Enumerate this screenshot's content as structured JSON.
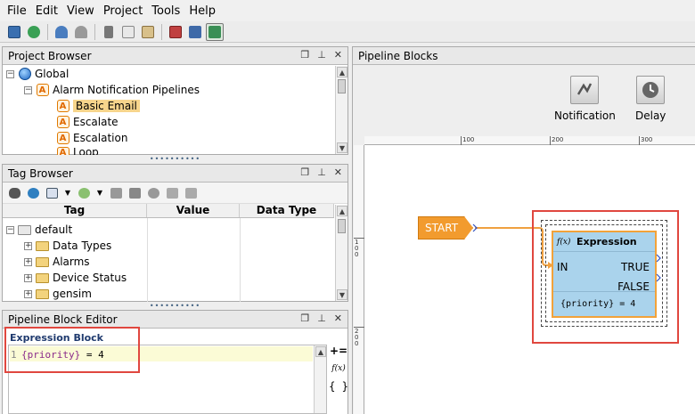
{
  "menu": [
    "File",
    "Edit",
    "View",
    "Project",
    "Tools",
    "Help"
  ],
  "toolbar_icons": [
    "save-icon",
    "save-all-icon",
    "undo-icon",
    "redo-icon",
    "cut-icon",
    "copy-icon",
    "paste-icon",
    "delete-icon",
    "publish-icon",
    "comm-mode-icon"
  ],
  "project_browser": {
    "title": "Project Browser",
    "items": [
      {
        "label": "Global",
        "icon": "globe-icon",
        "expander": "−"
      },
      {
        "label": "Alarm Notification Pipelines",
        "icon": "alarm-pipeline-icon",
        "expander": "−"
      },
      {
        "label": "Basic Email",
        "icon": "alarm-pipeline-icon",
        "selected": true
      },
      {
        "label": "Escalate",
        "icon": "alarm-pipeline-icon"
      },
      {
        "label": "Escalation",
        "icon": "alarm-pipeline-icon"
      },
      {
        "label": "Loop",
        "icon": "alarm-pipeline-icon"
      }
    ]
  },
  "tag_browser": {
    "title": "Tag Browser",
    "columns": [
      "Tag",
      "Value",
      "Data Type"
    ],
    "items": [
      {
        "label": "default",
        "expander": "−"
      },
      {
        "label": "Data Types",
        "expander": "+"
      },
      {
        "label": "Alarms",
        "expander": "+"
      },
      {
        "label": "Device Status",
        "expander": "+"
      },
      {
        "label": "gensim",
        "expander": "+"
      }
    ]
  },
  "block_editor": {
    "title": "Pipeline Block Editor",
    "section_label": "Expression Block",
    "line_number": "1",
    "code_identifier": "{priority}",
    "code_rest": " = 4",
    "side_tools": [
      "+=",
      "f(x)",
      "{ }"
    ]
  },
  "pipeline_blocks": {
    "title": "Pipeline Blocks",
    "palette": [
      {
        "label": "Notification",
        "icon": "notification-icon"
      },
      {
        "label": "Delay",
        "icon": "delay-icon"
      }
    ]
  },
  "ruler": {
    "h_labels": [
      "100",
      "200",
      "300"
    ],
    "v_labels": [
      "100",
      "200"
    ]
  },
  "canvas": {
    "start_label": "START",
    "expression": {
      "fx": "f(x)",
      "title": "Expression",
      "in_port": "IN",
      "true_port": "TRUE",
      "false_port": "FALSE",
      "code": "{priority} = 4"
    }
  },
  "colors": {
    "accent_orange": "#f29b2e",
    "block_blue": "#aad3ec",
    "highlight_red": "#e0473f",
    "selection": "#f7d58c"
  }
}
